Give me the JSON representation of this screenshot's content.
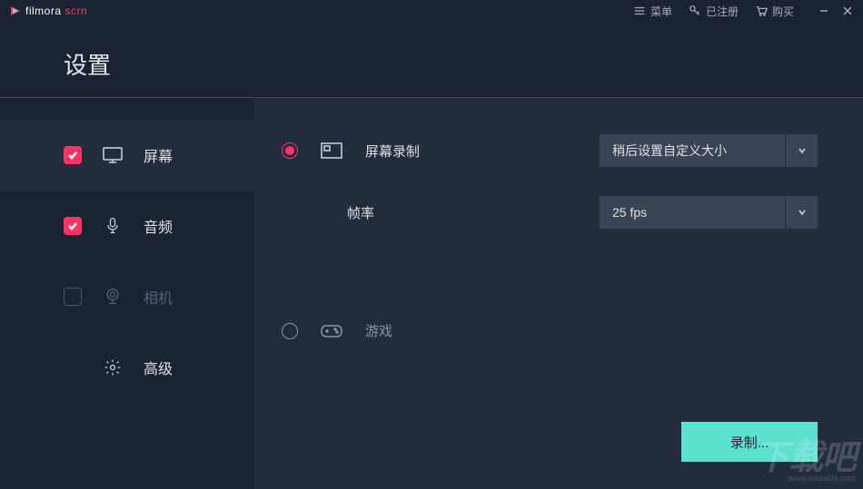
{
  "titlebar": {
    "logo_main": "filmora",
    "logo_sub": "scrn",
    "menu": "菜单",
    "registered": "已注册",
    "buy": "购买"
  },
  "header": {
    "title": "设置"
  },
  "sidebar": {
    "items": [
      {
        "label": "屏幕",
        "checked": true,
        "active": true
      },
      {
        "label": "音频",
        "checked": true,
        "active": false
      },
      {
        "label": "相机",
        "checked": false,
        "active": false,
        "disabled": true
      },
      {
        "label": "高级",
        "checked": null,
        "active": false
      }
    ]
  },
  "main": {
    "screen_record": {
      "label": "屏幕录制",
      "selected_option": "稍后设置自定义大小"
    },
    "fps": {
      "label": "帧率",
      "selected_option": "25 fps"
    },
    "game": {
      "label": "游戏"
    }
  },
  "actions": {
    "record": "录制..."
  },
  "watermark": {
    "brand": "下载吧",
    "url": "www.xiazaiba.com"
  }
}
